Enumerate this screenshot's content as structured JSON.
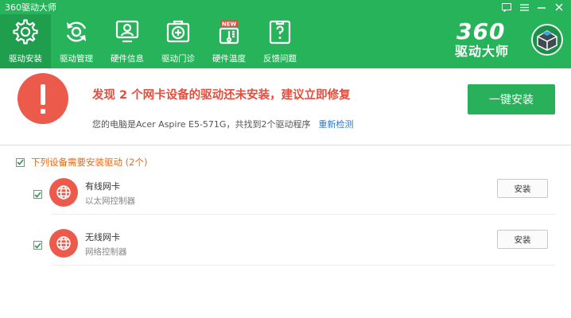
{
  "window": {
    "title": "360驱动大师"
  },
  "tabs": [
    {
      "label": "驱动安装",
      "icon": "gear-icon",
      "active": true
    },
    {
      "label": "驱动管理",
      "icon": "refresh-icon",
      "active": false
    },
    {
      "label": "硬件信息",
      "icon": "monitor-icon",
      "active": false
    },
    {
      "label": "驱动门诊",
      "icon": "first-aid-icon",
      "active": false
    },
    {
      "label": "硬件温度",
      "icon": "thermometer-icon",
      "active": false
    },
    {
      "label": "反馈问题",
      "icon": "feedback-icon",
      "active": false
    }
  ],
  "brand": {
    "top": "360",
    "bottom": "驱动大师"
  },
  "alert": {
    "headline": "发现 2 个网卡设备的驱动还未安装，建议立即修复",
    "sub": "您的电脑是Acer Aspire E5-571G，共找到2个驱动程序",
    "rescan": "重新检测",
    "button": "一键安装"
  },
  "section": {
    "title": "下列设备需要安装驱动 (2个)"
  },
  "drivers": [
    {
      "name": "有线网卡",
      "desc": "以太网控制器",
      "button": "安装"
    },
    {
      "name": "无线网卡",
      "desc": "网络控制器",
      "button": "安装"
    }
  ],
  "colors": {
    "green": "#27b35a",
    "green_active": "#1f9e4e",
    "red": "#ec5a4c",
    "link": "#2d77c8",
    "orange": "#e86a1c"
  }
}
